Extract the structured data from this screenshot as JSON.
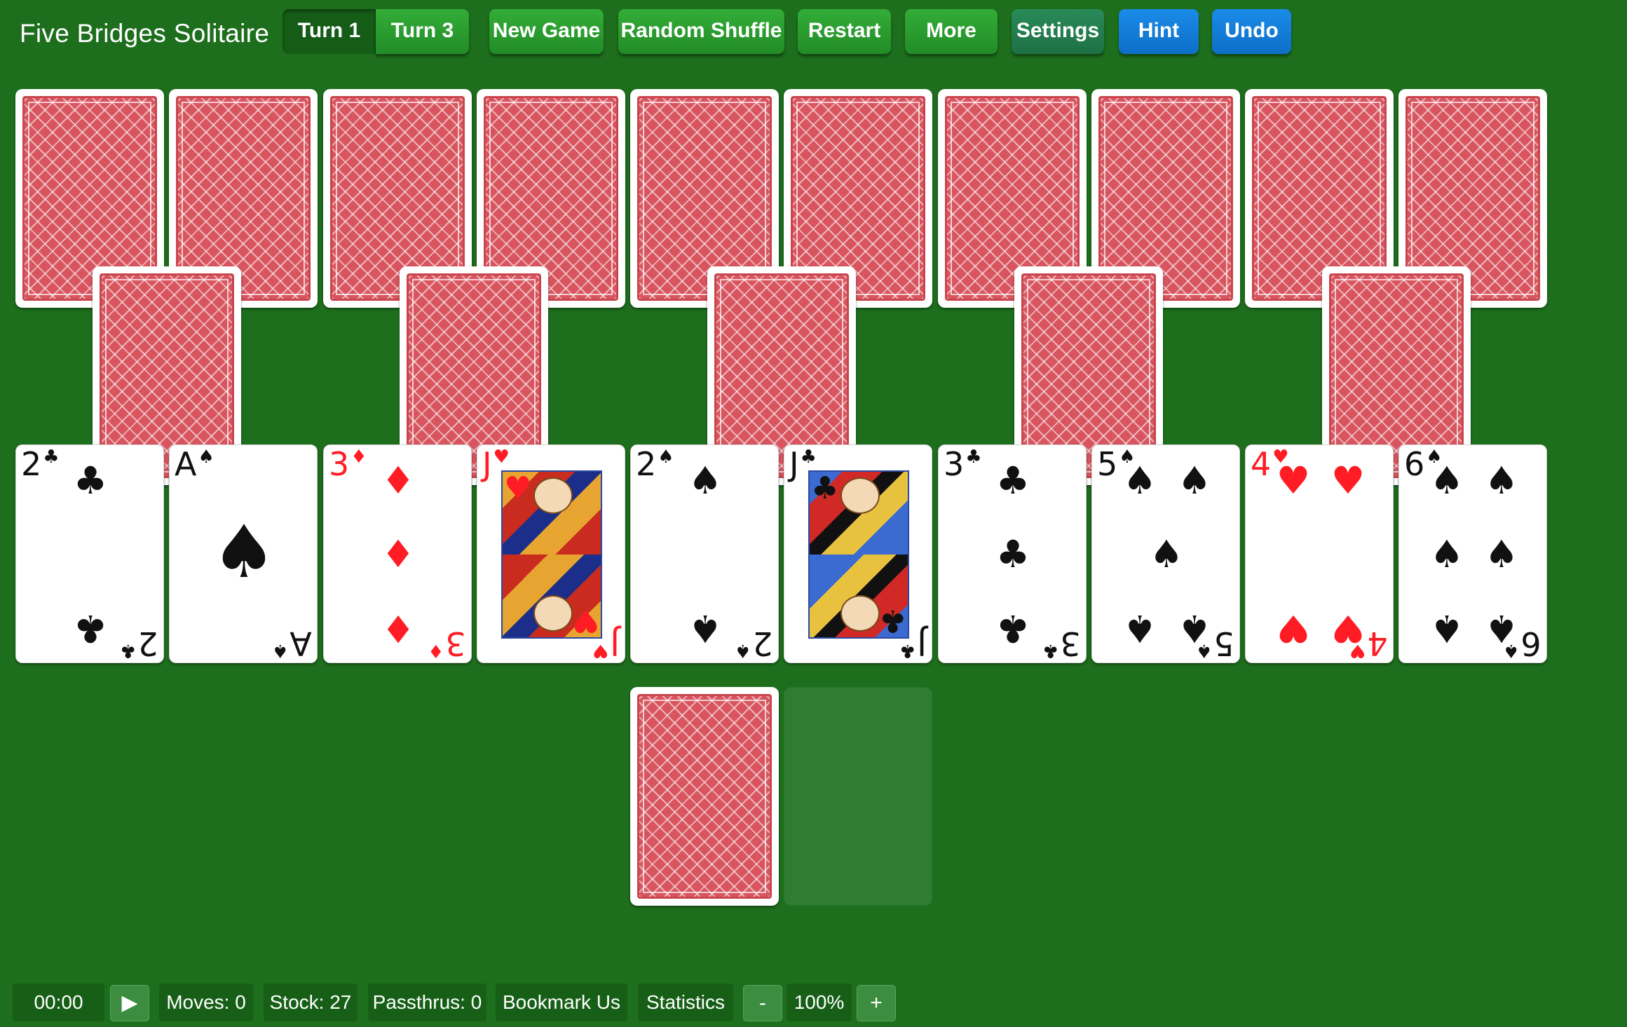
{
  "app": {
    "title": "Five Bridges Solitaire"
  },
  "toolbar": {
    "turn1": "Turn 1",
    "turn3": "Turn 3",
    "new_game": "New Game",
    "random_shuffle": "Random Shuffle",
    "restart": "Restart",
    "more": "More",
    "settings": "Settings",
    "hint": "Hint",
    "undo": "Undo"
  },
  "colors": {
    "table": "#1d6e1d",
    "red_suit": "#ff1c24",
    "black_suit": "#111111",
    "card_back": "#d8555f",
    "hint_blue": "#1a8be8"
  },
  "tableau_face_up": [
    {
      "rank": "2",
      "suit": "♣",
      "color": "black"
    },
    {
      "rank": "A",
      "suit": "♠",
      "color": "black"
    },
    {
      "rank": "3",
      "suit": "♦",
      "color": "red"
    },
    {
      "rank": "J",
      "suit": "♥",
      "color": "red"
    },
    {
      "rank": "2",
      "suit": "♠",
      "color": "black"
    },
    {
      "rank": "J",
      "suit": "♣",
      "color": "black"
    },
    {
      "rank": "3",
      "suit": "♣",
      "color": "black"
    },
    {
      "rank": "5",
      "suit": "♠",
      "color": "black"
    },
    {
      "rank": "4",
      "suit": "♥",
      "color": "red"
    },
    {
      "rank": "6",
      "suit": "♠",
      "color": "black"
    }
  ],
  "status": {
    "timer": "00:00",
    "play_icon": "▶",
    "moves": "Moves: 0",
    "stock": "Stock: 27",
    "passthrus": "Passthrus: 0",
    "bookmark": "Bookmark Us",
    "statistics": "Statistics",
    "zoom_out": "-",
    "zoom": "100%",
    "zoom_in": "+"
  }
}
